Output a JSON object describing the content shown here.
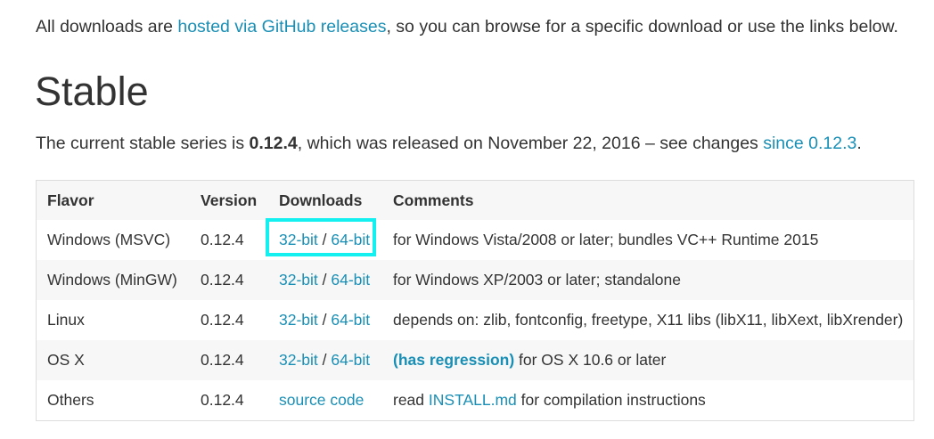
{
  "intro": {
    "prefix": "All downloads are ",
    "link": "hosted via GitHub releases",
    "suffix": ", so you can browse for a specific download or use the links below."
  },
  "heading": "Stable",
  "current": {
    "prefix": "The current stable series is ",
    "version": "0.12.4",
    "middle": ", which was released on November 22, 2016 – see changes ",
    "link": "since 0.12.3",
    "suffix": "."
  },
  "table": {
    "headers": [
      "Flavor",
      "Version",
      "Downloads",
      "Comments"
    ],
    "rows": [
      {
        "flavor": "Windows (MSVC)",
        "version": "0.12.4",
        "dl1": "32-bit",
        "sep": " / ",
        "dl2": "64-bit",
        "comment": "for Windows Vista/2008 or later; bundles VC++ Runtime 2015"
      },
      {
        "flavor": "Windows (MinGW)",
        "version": "0.12.4",
        "dl1": "32-bit",
        "sep": " / ",
        "dl2": "64-bit",
        "comment": "for Windows XP/2003 or later; standalone"
      },
      {
        "flavor": "Linux",
        "version": "0.12.4",
        "dl1": "32-bit",
        "sep": " / ",
        "dl2": "64-bit",
        "comment": "depends on: zlib, fontconfig, freetype, X11 libs (libX11, libXext, libXrender)"
      },
      {
        "flavor": "OS X",
        "version": "0.12.4",
        "dl1": "32-bit",
        "sep": " / ",
        "dl2": "64-bit",
        "comment_link": "(has regression)",
        "comment": " for OS X 10.6 or later"
      },
      {
        "flavor": "Others",
        "version": "0.12.4",
        "dl_source": "source code",
        "comment_prefix": "read ",
        "comment_link": "INSTALL.md",
        "comment": " for compilation instructions"
      }
    ]
  },
  "colors": {
    "link": "#1a8fb5",
    "text": "#333333",
    "row_stripe": "#f7f7f7",
    "highlight": "#14f0f0"
  }
}
